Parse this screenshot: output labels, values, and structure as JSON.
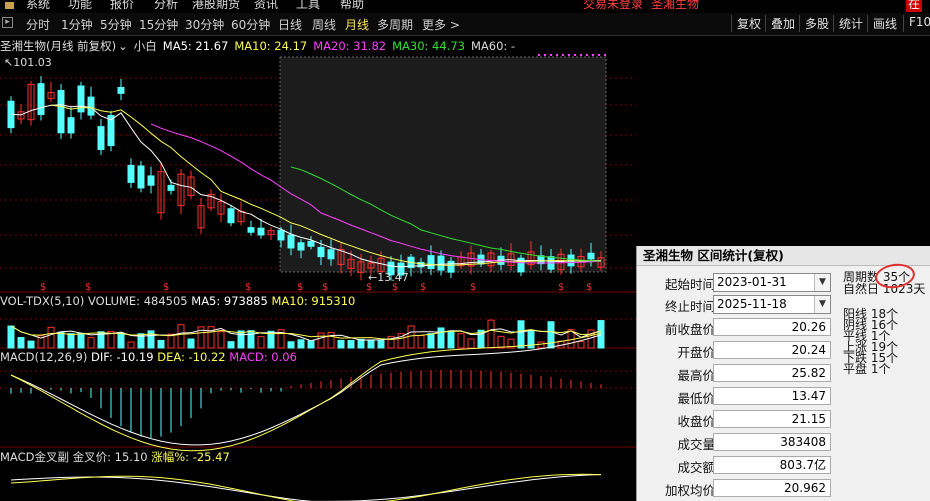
{
  "menu": [
    "系统",
    "功能",
    "报价",
    "分析",
    "港股期货",
    "资讯",
    "工具",
    "帮助"
  ],
  "login_status": "交易未登录",
  "stock_name_top": "圣湘生物",
  "right_top_labels": [
    "在",
    "F10"
  ],
  "tabs": [
    "分时",
    "1分钟",
    "5分钟",
    "15分钟",
    "30分钟",
    "60分钟",
    "日线",
    "周线",
    "月线",
    "多周期",
    "更多 >"
  ],
  "active_tab": "月线",
  "toolbar": [
    "复权",
    "叠加",
    "多股",
    "统计",
    "画线",
    "F10"
  ],
  "main_legend": {
    "title": "圣湘生物(月线 前复权)",
    "mode": "小白",
    "ma5": "MA5: 21.67",
    "ma10": "MA10: 24.17",
    "ma20": "MA20: 31.82",
    "ma30": "MA30: 44.73",
    "ma60": "MA60: -"
  },
  "price_high_label": "101.03",
  "price_low_label": "13.47",
  "vol_legend": {
    "name": "VOL-TDX(5,10)",
    "volume": "VOLUME: 484505",
    "ma5": "MA5: 973885",
    "ma10": "MA10: 915310"
  },
  "macd_legend": {
    "name": "MACD(12,26,9)",
    "dif": "DIF: -10.19",
    "dea": "DEA: -10.22",
    "macd": "MACD: 0.06"
  },
  "macd2_legend": {
    "name": "MACD金叉副",
    "price": "金叉价: 15.10",
    "pct": "涨幅%: -25.47"
  },
  "dividend_marker": "$",
  "panel": {
    "title": "圣湘生物 区间统计(复权)",
    "start_label": "起始时间",
    "start_value": "2023-01-31",
    "end_label": "终止时间",
    "end_value": "2025-11-18",
    "rows": [
      {
        "label": "前收盘价",
        "value": "20.26"
      },
      {
        "label": "开盘价",
        "value": "20.24"
      },
      {
        "label": "最高价",
        "value": "25.82"
      },
      {
        "label": "最低价",
        "value": "13.47"
      },
      {
        "label": "收盘价",
        "value": "21.15"
      },
      {
        "label": "成交量",
        "value": "383408"
      },
      {
        "label": "成交额",
        "value": "803.7亿"
      },
      {
        "label": "加权均价",
        "value": "20.962"
      }
    ],
    "periods_label": "周期数",
    "periods_value": "35个",
    "natural_days_label": "自然日",
    "natural_days_value": "1023天",
    "counts": [
      {
        "label": "阳线",
        "value": "18个"
      },
      {
        "label": "阴线",
        "value": "16个"
      },
      {
        "label": "平线",
        "value": "1个"
      },
      {
        "label": "上涨",
        "value": "19个"
      },
      {
        "label": "下跌",
        "value": "15个"
      },
      {
        "label": "平盘",
        "value": "1个"
      }
    ]
  },
  "colors": {
    "up": "#ff3030",
    "down": "#54ffff",
    "ma5": "#ffffff",
    "ma10": "#ffff50",
    "ma20": "#ff40ff",
    "ma30": "#30e030",
    "grid": "#7a0000",
    "highlight": "#e03030"
  }
}
